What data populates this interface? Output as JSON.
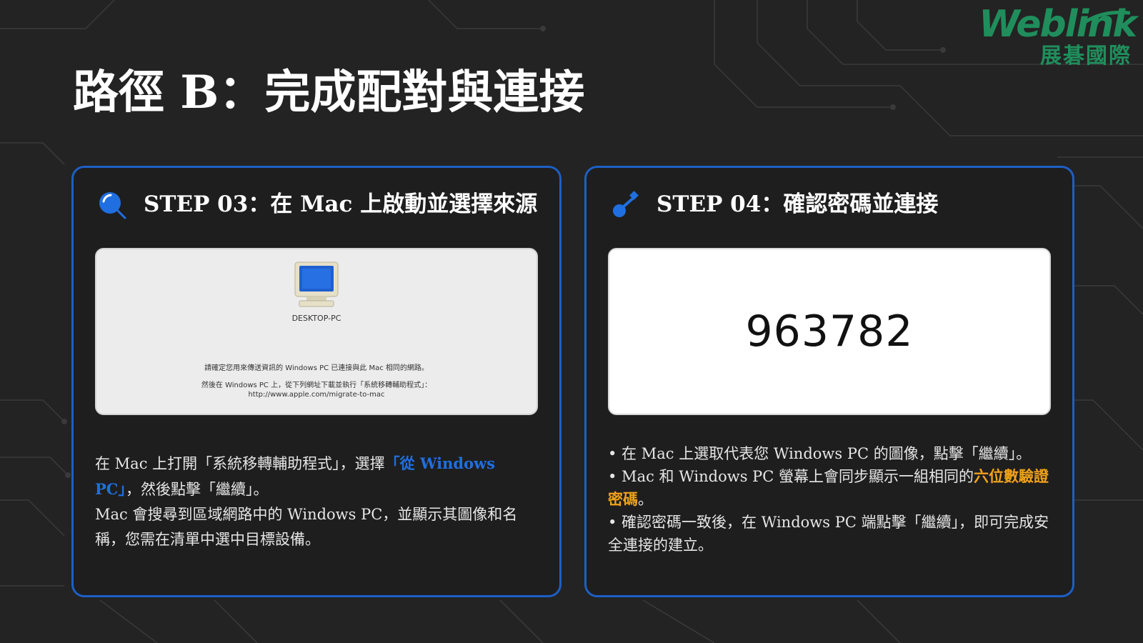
{
  "page_title": "路徑 B：完成配對與連接",
  "logo": {
    "brand": "Weblink",
    "subtitle": "展碁國際",
    "brand_color": "#1f8e5c"
  },
  "colors": {
    "accent_blue": "#1f6fe0",
    "card_border": "#1d5fc4",
    "highlight_orange": "#f0a21a"
  },
  "step03": {
    "icon": "search-icon",
    "title": "STEP 03：在 Mac 上啟動並選擇來源",
    "screenshot": {
      "device_name": "DESKTOP-PC",
      "line1": "請確定您用來傳送資訊的 Windows PC 已連接與此 Mac 相同的網路。",
      "line2": "然後在 Windows PC 上，從下列網址下載並執行「系統移轉輔助程式」：",
      "url": "http://www.apple.com/migrate-to-mac"
    },
    "desc": {
      "part1": "在 Mac 上打開「系統移轉輔助程式」，選擇",
      "highlight": "「從 Windows PC」",
      "part2": "，然後點擊「繼續」。",
      "para2": "Mac 會搜尋到區域網路中的 Windows PC，並顯示其圖像和名稱，您需在清單中選中目標設備。"
    }
  },
  "step04": {
    "icon": "key-icon",
    "title": "STEP 04：確認密碼並連接",
    "code": "963782",
    "bullets": {
      "b1": "• 在 Mac 上選取代表您 Windows PC 的圖像，點擊「繼續」。",
      "b2_part1": "• Mac 和 Windows PC 螢幕上會同步顯示一組相同的",
      "b2_highlight": "六位數驗證密碼",
      "b2_part2": "。",
      "b3": "• 確認密碼一致後，在 Windows PC 端點擊「繼續」，即可完成安全連接的建立。"
    }
  }
}
